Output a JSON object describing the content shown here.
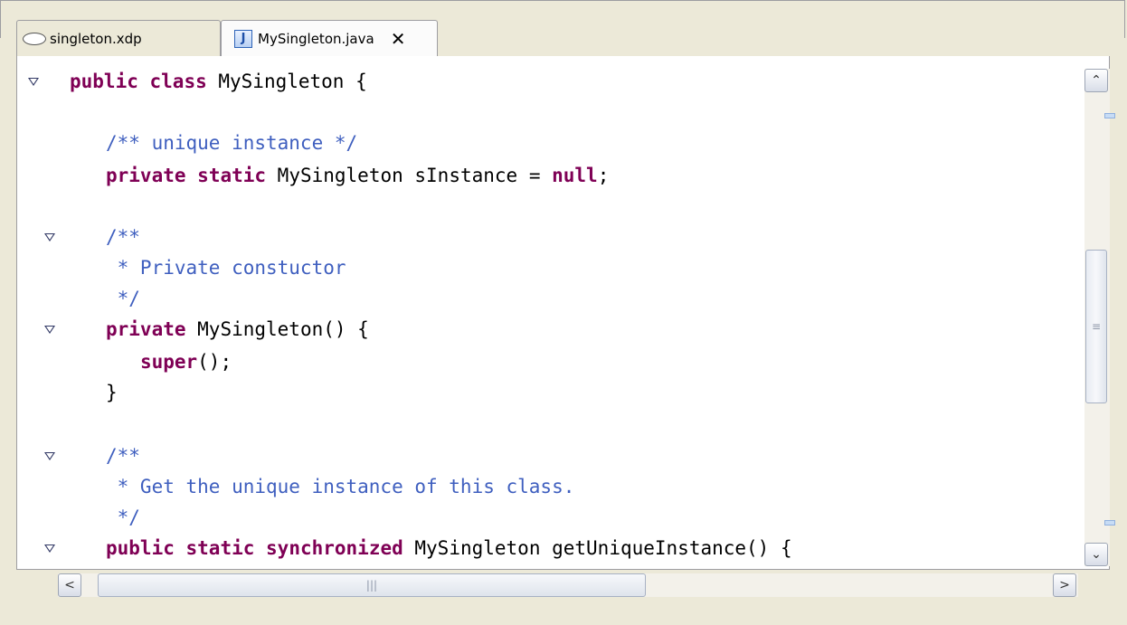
{
  "tabs": [
    {
      "label": "singleton.xdp",
      "icon": "xdp-file-icon",
      "active": false
    },
    {
      "label": "MySingleton.java",
      "icon": "java-file-icon",
      "icon_glyph": "J",
      "active": true,
      "close_glyph": "✕"
    }
  ],
  "code_lines": [
    [
      {
        "t": "public",
        "c": "kw"
      },
      {
        "t": " "
      },
      {
        "t": "class",
        "c": "kw"
      },
      {
        "t": " MySingleton {"
      }
    ],
    [
      {
        "t": ""
      }
    ],
    [
      {
        "t": "/** unique instance */",
        "c": "cm"
      }
    ],
    [
      {
        "t": "private",
        "c": "kw"
      },
      {
        "t": " "
      },
      {
        "t": "static",
        "c": "kw"
      },
      {
        "t": " MySingleton sInstance = "
      },
      {
        "t": "null",
        "c": "kw"
      },
      {
        "t": ";"
      }
    ],
    [
      {
        "t": ""
      }
    ],
    [
      {
        "t": "/**",
        "c": "cm"
      }
    ],
    [
      {
        "t": " * Private constuctor",
        "c": "cm"
      }
    ],
    [
      {
        "t": " */",
        "c": "cm"
      }
    ],
    [
      {
        "t": "private",
        "c": "kw"
      },
      {
        "t": " MySingleton() {"
      }
    ],
    [
      {
        "t": "   "
      },
      {
        "t": "super",
        "c": "kw"
      },
      {
        "t": "();"
      }
    ],
    [
      {
        "t": "}"
      }
    ],
    [
      {
        "t": ""
      }
    ],
    [
      {
        "t": "/**",
        "c": "cm"
      }
    ],
    [
      {
        "t": " * Get the unique instance of this class.",
        "c": "cm"
      }
    ],
    [
      {
        "t": " */",
        "c": "cm"
      }
    ],
    [
      {
        "t": "public",
        "c": "kw"
      },
      {
        "t": " "
      },
      {
        "t": "static",
        "c": "kw"
      },
      {
        "t": " "
      },
      {
        "t": "synchronized",
        "c": "kw"
      },
      {
        "t": " MySingleton getUniqueInstance() {"
      }
    ]
  ],
  "fold_lines": [
    0,
    5,
    8,
    12,
    15
  ],
  "scrollbar": {
    "up_glyph": "⌃",
    "down_glyph": "⌄",
    "left_glyph": "<",
    "right_glyph": ">",
    "v_grip": "≡",
    "h_grip": "|||"
  },
  "colors": {
    "keyword": "#7f0055",
    "comment": "#3f5fbf",
    "text": "#000000",
    "background": "#ffffff"
  }
}
